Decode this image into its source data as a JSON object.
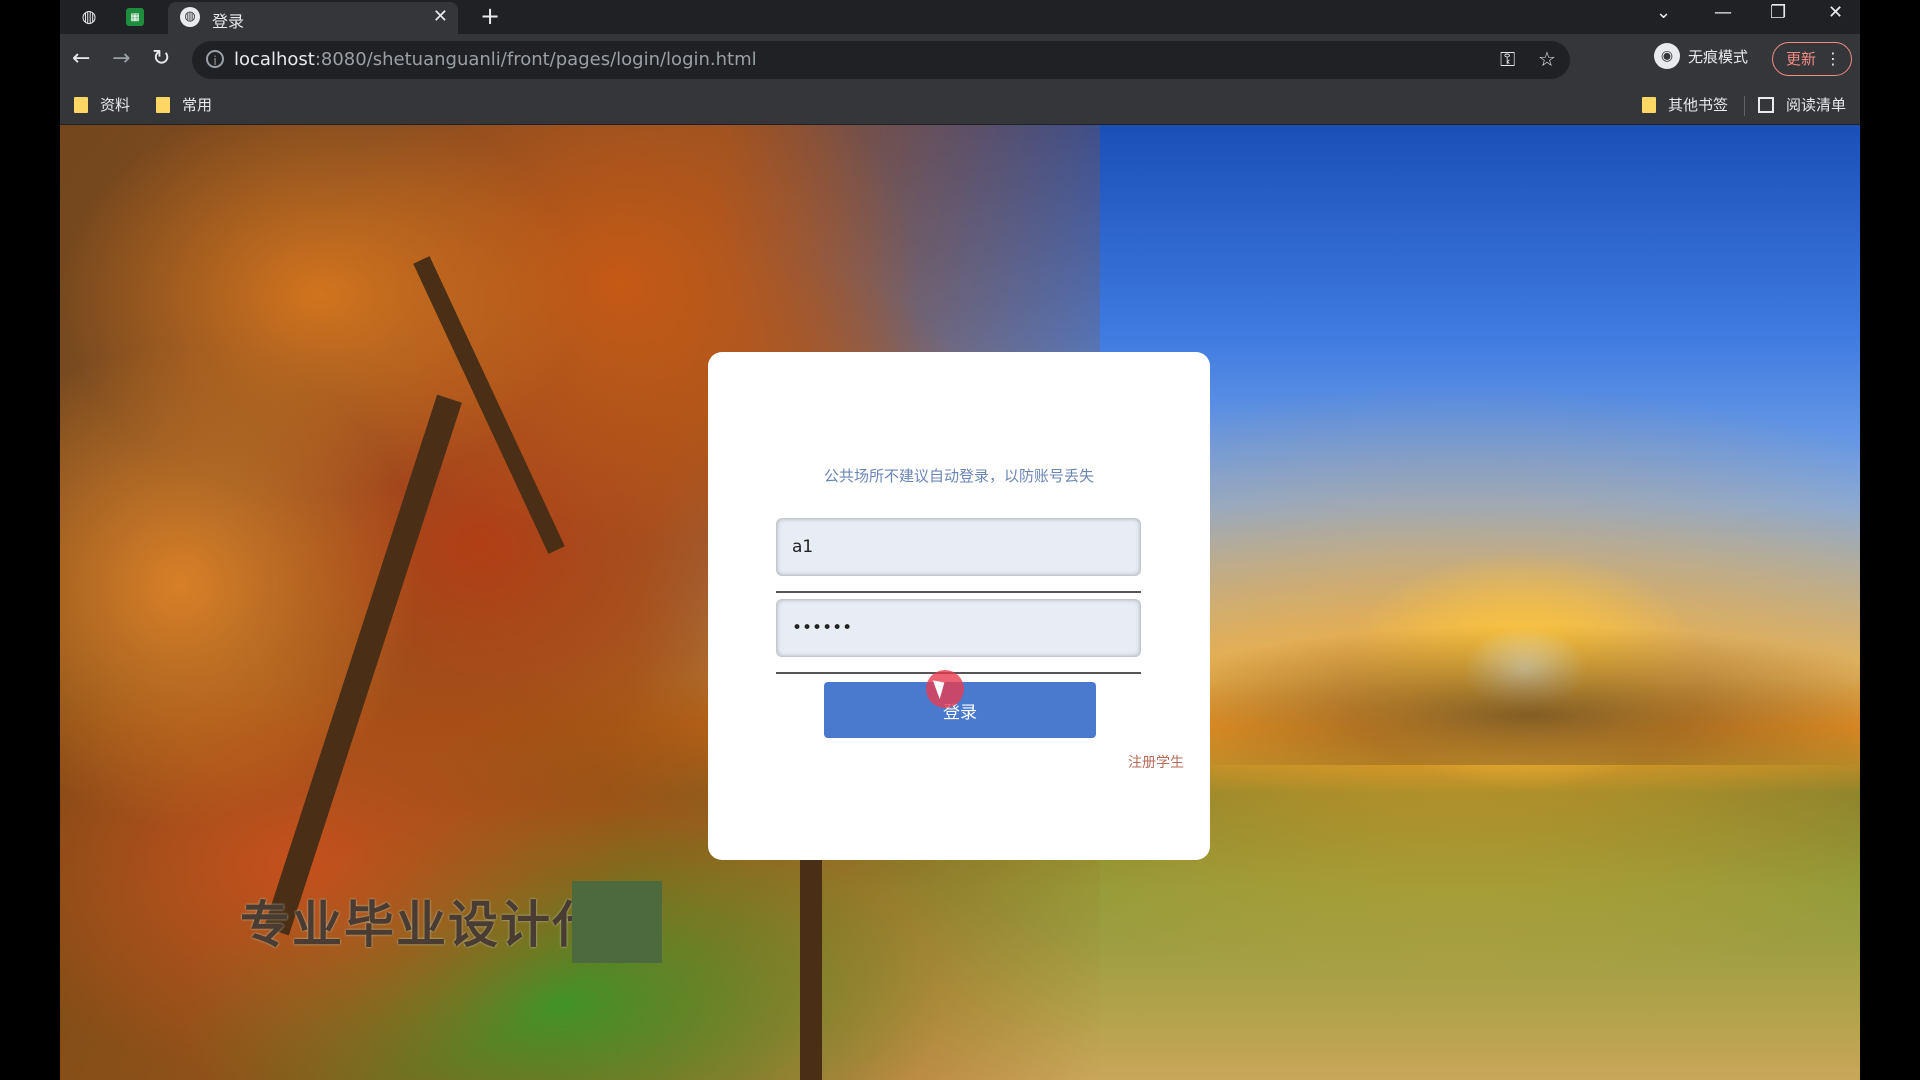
{
  "browser": {
    "tab_title": "登录",
    "new_tab_symbol": "+",
    "url_host": "localhost",
    "url_rest": ":8080/shetuanguanli/front/pages/login/login.html",
    "incognito_label": "无痕模式",
    "update_label": "更新",
    "bookmarks": [
      "资料",
      "常用"
    ],
    "other_bookmarks": "其他书签",
    "reading_list": "阅读清单"
  },
  "login": {
    "hint": "公共场所不建议自动登录，以防账号丢失",
    "username_value": "a1",
    "password_value": "aaaaaa",
    "submit_label": "登录",
    "register_link": "注册学生"
  },
  "overlay": {
    "watermark_text": "专业毕业设计代"
  },
  "colors": {
    "button": "#4a7acd",
    "hint": "#6b86b6",
    "link": "#b56b57"
  }
}
